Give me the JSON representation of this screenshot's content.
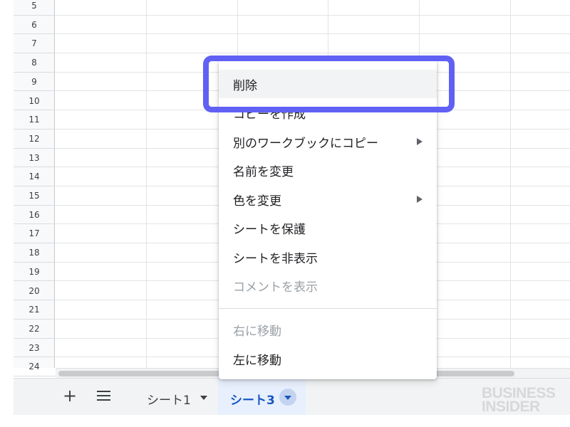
{
  "sheet": {
    "row_numbers": [
      "5",
      "6",
      "7",
      "8",
      "9",
      "10",
      "11",
      "12",
      "13",
      "14",
      "15",
      "16",
      "17",
      "18",
      "19",
      "20",
      "21",
      "22",
      "23",
      "24"
    ]
  },
  "context_menu": {
    "items": [
      {
        "label": "削除",
        "state": "hover",
        "submenu": false,
        "disabled": false
      },
      {
        "label": "コピーを作成",
        "submenu": false,
        "disabled": false
      },
      {
        "label": "別のワークブックにコピー",
        "submenu": true,
        "disabled": false
      },
      {
        "label": "名前を変更",
        "submenu": false,
        "disabled": false
      },
      {
        "label": "色を変更",
        "submenu": true,
        "disabled": false
      },
      {
        "label": "シートを保護",
        "submenu": false,
        "disabled": false
      },
      {
        "label": "シートを非表示",
        "submenu": false,
        "disabled": false
      },
      {
        "label": "コメントを表示",
        "submenu": false,
        "disabled": true
      },
      {
        "label": "右に移動",
        "submenu": false,
        "disabled": true
      },
      {
        "label": "左に移動",
        "submenu": false,
        "disabled": false
      }
    ]
  },
  "tab_bar": {
    "add_sheet_icon": "+",
    "all_sheets_icon": "menu-icon",
    "sheets": [
      {
        "label": "シート1",
        "active": false
      },
      {
        "label": "シート3",
        "active": true
      }
    ]
  },
  "watermark": {
    "line1": "BUSINESS",
    "line2": "INSIDER"
  },
  "colors": {
    "highlight": "#6160f4",
    "active_tab_bg": "#e8f0fe",
    "active_tab_text": "#1a57c2",
    "menu_hover_bg": "#f1f3f4",
    "disabled_text": "#9aa0a6"
  }
}
